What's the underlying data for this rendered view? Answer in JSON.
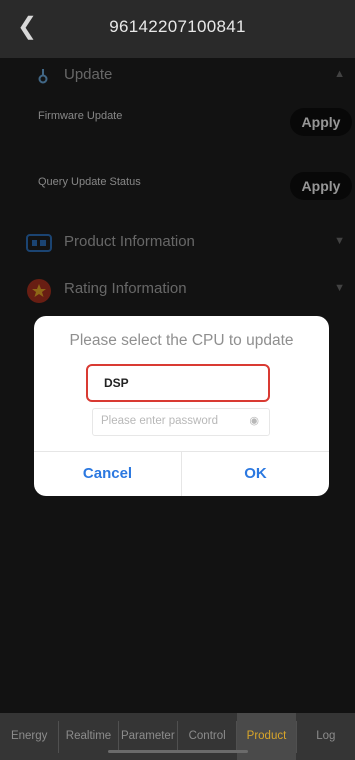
{
  "header": {
    "back_icon": "chevron-left-icon",
    "title": "96142207100841"
  },
  "sections": {
    "update": {
      "label": "Update",
      "icon": "update-icon"
    },
    "firmware": {
      "label": "Firmware Update",
      "button": "Apply"
    },
    "query": {
      "label": "Query Update Status",
      "button": "Apply"
    },
    "product": {
      "label": "Product Information",
      "icon": "product-info-icon"
    },
    "rating": {
      "label": "Rating Information",
      "icon": "rating-info-icon"
    }
  },
  "dialog": {
    "title": "Please select the CPU to update",
    "selected_cpu": "DSP",
    "password_placeholder": "Please enter password",
    "cancel_label": "Cancel",
    "ok_label": "OK"
  },
  "tabs": [
    {
      "label": "Energy"
    },
    {
      "label": "Realtime"
    },
    {
      "label": "Parameter"
    },
    {
      "label": "Control"
    },
    {
      "label": "Product",
      "active": true
    },
    {
      "label": "Log"
    }
  ],
  "colors": {
    "accent": "#2b78e0",
    "active_tab": "#d8a52a",
    "highlight": "#d93a32"
  }
}
